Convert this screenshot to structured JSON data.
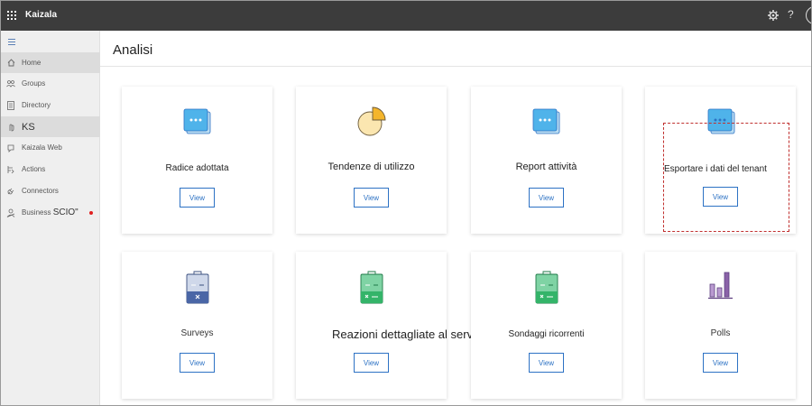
{
  "app": {
    "title": "Kaizala"
  },
  "topbar": {
    "help_glyph": "?",
    "icons": [
      "apps-grid-icon",
      "gear-icon",
      "help-icon",
      "avatar-icon"
    ]
  },
  "sidebar": {
    "items": [
      {
        "label": "Home",
        "icon": "home-icon"
      },
      {
        "label": "Groups",
        "icon": "groups-icon"
      },
      {
        "label": "Directory",
        "icon": "directory-icon"
      },
      {
        "label": "KS",
        "icon": "hand-icon"
      },
      {
        "label": "Kaizala Web",
        "icon": "web-icon"
      },
      {
        "label": "Actions",
        "icon": "actions-icon"
      },
      {
        "label": "Connectors",
        "icon": "plug-icon"
      },
      {
        "label": "Business",
        "label_suffix": "SCIO\"",
        "icon": "business-icon"
      }
    ]
  },
  "main": {
    "title": "Analisi",
    "view_label": "View",
    "cards": [
      {
        "label": "Radice adottata",
        "icon": "chat-bubbles-icon"
      },
      {
        "label": "Tendenze di utilizzo",
        "icon": "pie-chart-icon"
      },
      {
        "label": "Report attività",
        "icon": "chat-bubbles-icon"
      },
      {
        "label": "Esportare i dati del tenant",
        "icon": "chat-bubbles-icon"
      },
      {
        "label": "Surveys",
        "icon": "survey-clipboard-icon"
      },
      {
        "label": "Reazioni dettagliate al servizio",
        "icon": "feedback-clipboard-icon"
      },
      {
        "label": "Sondaggi ricorrenti",
        "icon": "recurring-clipboard-icon"
      },
      {
        "label": "Polls",
        "icon": "poll-bars-icon"
      }
    ]
  },
  "colors": {
    "topbar": "#3c3c3c",
    "sidebar": "#efefef",
    "accent_blue": "#2d72c4",
    "chat_icon": "#4fb3ea",
    "pie_fill": "#fbe6b0",
    "pie_slice": "#f4b52c",
    "survey_icon": "#4a66a6",
    "feedback_icon": "#34b469",
    "poll_icon": "#8a62a8",
    "highlight": "#c0302f"
  }
}
